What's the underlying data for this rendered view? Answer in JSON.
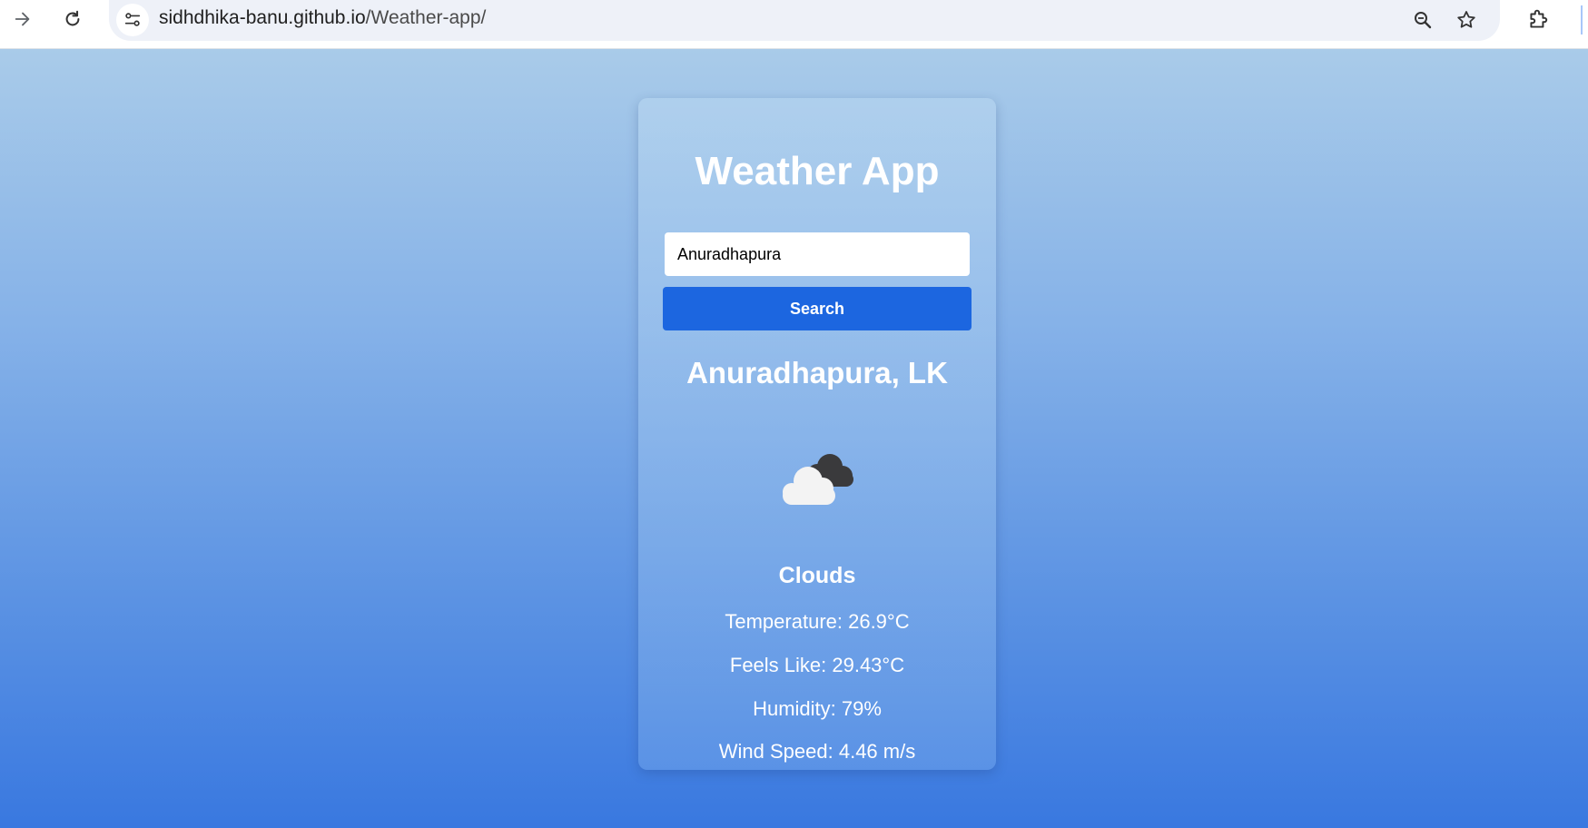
{
  "browser": {
    "url_host": "sidhdhika-banu.github.io",
    "url_path": "/Weather-app/",
    "icons": [
      "forward-icon",
      "reload-icon",
      "site-info-icon",
      "zoom-icon",
      "bookmark-star-icon",
      "extensions-icon"
    ]
  },
  "app": {
    "title": "Weather App",
    "search": {
      "value": "Anuradhapura",
      "button_label": "Search"
    },
    "location": "Anuradhapura, LK",
    "weather_icon": "clouds-icon",
    "condition": "Clouds",
    "details": {
      "temperature": "Temperature: 26.9°C",
      "feels_like": "Feels Like: 29.43°C",
      "humidity": "Humidity: 79%",
      "wind_speed": "Wind Speed: 4.46 m/s"
    }
  },
  "colors": {
    "button": "#1c66e0",
    "gradient_top": "#a9cbe9",
    "gradient_bottom": "#3978e0"
  }
}
